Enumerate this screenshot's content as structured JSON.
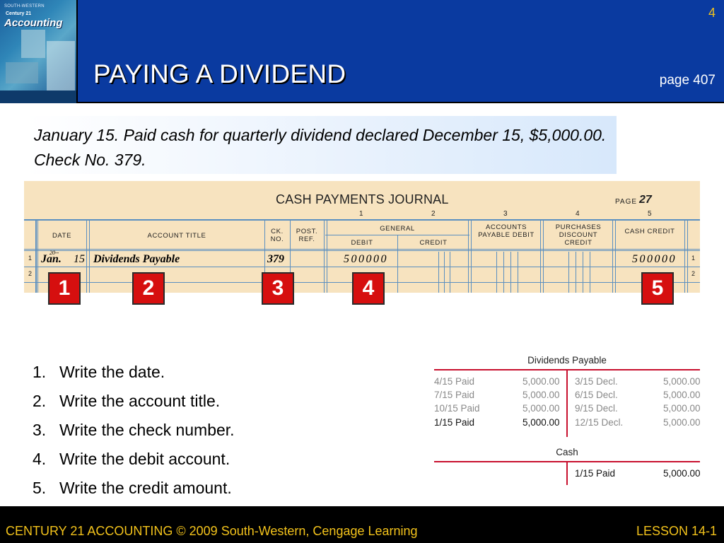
{
  "header": {
    "title": "PAYING A DIVIDEND",
    "slide_number": "4",
    "page_ref": "page 407",
    "book": {
      "brand": "Accounting",
      "series": "Century 21",
      "small": "SOUTH-WESTERN"
    }
  },
  "transaction": {
    "text": "January 15.  Paid cash for quarterly dividend declared December 15, $5,000.00.  Check No. 379."
  },
  "journal": {
    "title": "CASH PAYMENTS JOURNAL",
    "page_label": "PAGE",
    "page_value": "27",
    "column_numbers": [
      "1",
      "2",
      "3",
      "4",
      "5"
    ],
    "headers": {
      "date": "DATE",
      "account_title": "ACCOUNT TITLE",
      "ck_no": "CK. NO.",
      "post_ref": "POST. REF.",
      "general": "GENERAL",
      "debit": "DEBIT",
      "credit": "CREDIT",
      "accounts_payable_debit": "ACCOUNTS PAYABLE DEBIT",
      "purchases_discount_credit": "PURCHASES DISCOUNT CREDIT",
      "cash_credit": "CASH CREDIT"
    },
    "row1": {
      "line": "1",
      "year": "20--",
      "month": "Jan.",
      "day": "15",
      "account": "Dividends Payable",
      "ck_no": "379",
      "general_debit": "500000",
      "cash_credit": "500000"
    },
    "row2": {
      "line": "2"
    }
  },
  "badges": [
    "1",
    "2",
    "3",
    "4",
    "5"
  ],
  "steps": [
    {
      "num": "1.",
      "text": "Write the date."
    },
    {
      "num": "2.",
      "text": "Write the account title."
    },
    {
      "num": "3.",
      "text": "Write the check number."
    },
    {
      "num": "4.",
      "text": "Write the debit account."
    },
    {
      "num": "5.",
      "text": "Write the credit amount."
    }
  ],
  "dividends_payable": {
    "title": "Dividends Payable",
    "debits": [
      {
        "date": "4/15 Paid",
        "amount": "5,000.00"
      },
      {
        "date": "7/15 Paid",
        "amount": "5,000.00"
      },
      {
        "date": "10/15 Paid",
        "amount": "5,000.00"
      },
      {
        "date": "1/15 Paid",
        "amount": "5,000.00"
      }
    ],
    "credits": [
      {
        "date": "3/15 Decl.",
        "amount": "5,000.00"
      },
      {
        "date": "6/15 Decl.",
        "amount": "5,000.00"
      },
      {
        "date": "9/15 Decl.",
        "amount": "5,000.00"
      },
      {
        "date": "12/15 Decl.",
        "amount": "5,000.00"
      }
    ]
  },
  "cash": {
    "title": "Cash",
    "credits": [
      {
        "date": "1/15 Paid",
        "amount": "5,000.00"
      }
    ]
  },
  "footer": {
    "left": "CENTURY 21 ACCOUNTING © 2009 South-Western, Cengage Learning",
    "right": "LESSON  14-1"
  },
  "colors": {
    "header_bg": "#0a3aa0",
    "title": "#ffffff",
    "accent_gold": "#f2c21b",
    "badge_red": "#d60f0f",
    "journal_bg": "#f7e3bf",
    "rule_blue": "#5a8fc0",
    "t_account_red": "#c8102e"
  }
}
